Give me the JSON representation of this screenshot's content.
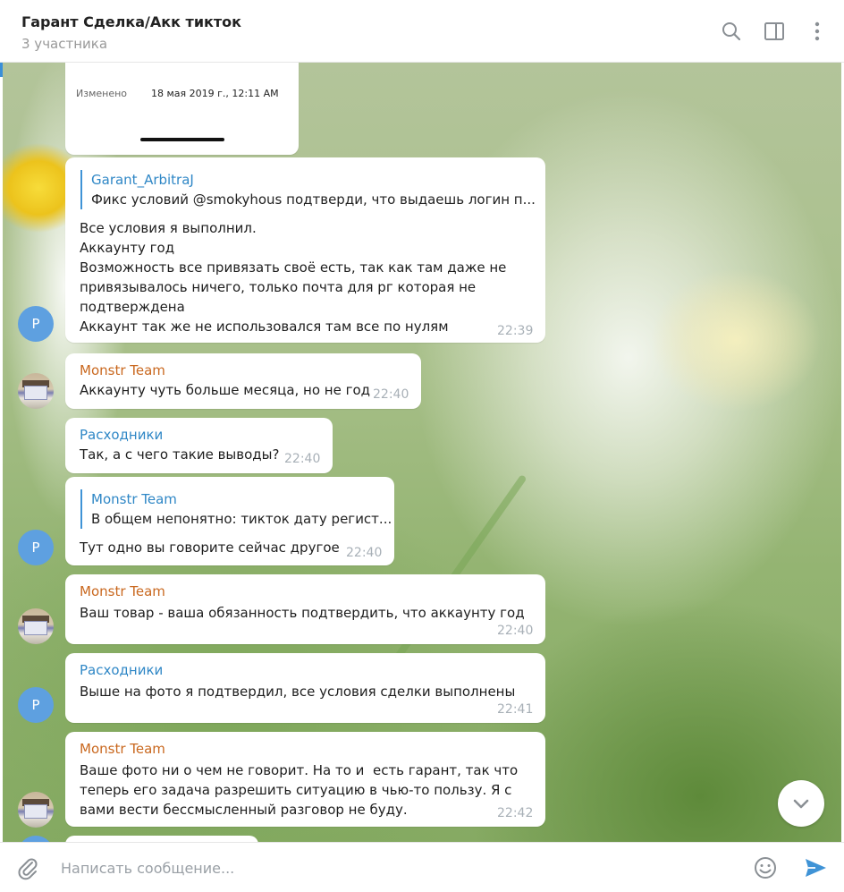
{
  "header": {
    "title": "Гарант Сделка/Акк тикток",
    "subtitle": "3 участника"
  },
  "file_card": {
    "label": "Изменено",
    "value": "18 мая 2019 г., 12:11 AM"
  },
  "messages": [
    {
      "reply_name": "Garant_ArbitraJ",
      "reply_text": "Фикс условий  @smokyhous подтверди, что выдаешь логин п...",
      "text": "Все условия я выполнил.\nАккаунту год\nВозможность все привязать своё есть, так как там даже не\nпривязывалось ничего, только почта для рг которая не\nподтверждена\nАккаунт так же не использовался там все по нулям",
      "time": "22:39",
      "avatar": "Р"
    },
    {
      "sender": "Monstr Team",
      "text": "Аккаунту чуть больше месяца, но не год",
      "time": "22:40"
    },
    {
      "sender": "Расходники",
      "text": "Так, а с чего такие выводы?",
      "time": "22:40"
    },
    {
      "reply_name": "Monstr Team",
      "reply_text": "В общем непонятно: тикток дату регист...",
      "text": "Тут одно вы говорите сейчас другое",
      "time": "22:40",
      "avatar": "Р"
    },
    {
      "sender": "Monstr Team",
      "text": "Ваш товар - ваша обязанность подтвердить, что аккаунту год",
      "time": "22:40"
    },
    {
      "sender": "Расходники",
      "text": "Выше на фото я подтвердил, все условия сделки выполнены",
      "time": "22:41",
      "avatar": "Р"
    },
    {
      "sender": "Monstr Team",
      "text": "Ваше фото ни о чем не говорит. На то и  есть гарант, так что\nтеперь его задача разрешить ситуацию в чью-то пользу. Я с\nвами вести бессмысленный разговор не буду.",
      "time": "22:42"
    }
  ],
  "composer": {
    "placeholder": "Написать сообщение..."
  },
  "icons": {
    "search": "search-icon",
    "sidebar": "sidebar-toggle-icon",
    "more": "more-vertical-icon",
    "scroll": "chevron-down-icon",
    "attach": "paperclip-icon",
    "emoji": "emoji-icon",
    "send": "send-icon"
  },
  "colors": {
    "accent": "#3f93d6",
    "sender_orange": "#c9681f",
    "sender_blue": "#2f87c6",
    "avatar_blue": "#5ea0e0"
  }
}
